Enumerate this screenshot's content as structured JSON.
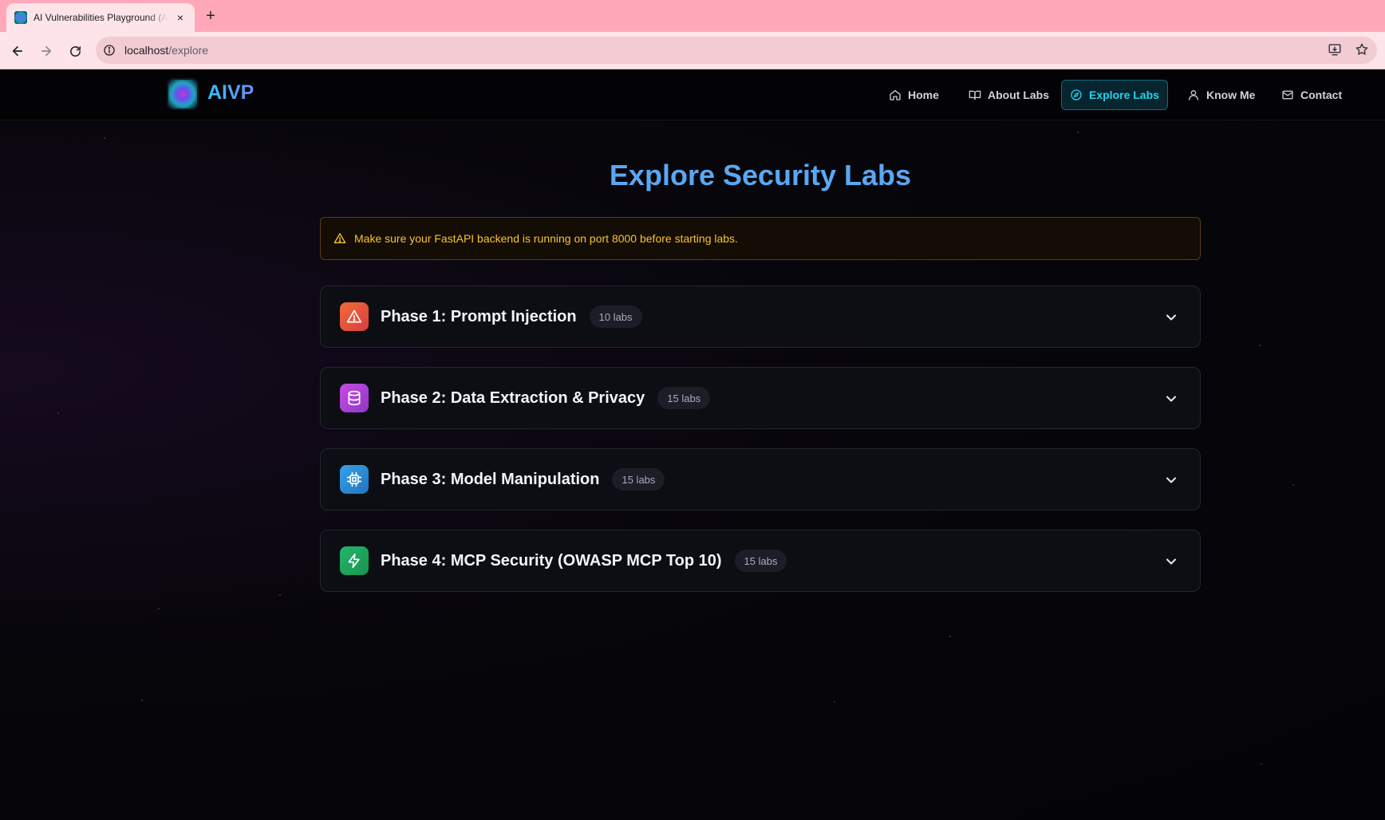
{
  "browser": {
    "tab_title": "AI Vulnerabilities Playground (AIVP)",
    "tab_close": "×",
    "new_tab": "+",
    "url_host": "localhost",
    "url_path": "/explore"
  },
  "site": {
    "brand": "AIVP",
    "nav": [
      {
        "label": "Home",
        "icon": "home-icon"
      },
      {
        "label": "About Labs",
        "icon": "book-icon"
      },
      {
        "label": "Explore Labs",
        "icon": "compass-icon",
        "active": true
      },
      {
        "label": "Know Me",
        "icon": "user-icon"
      },
      {
        "label": "Contact",
        "icon": "mail-icon"
      }
    ],
    "colors": {
      "accent": "#22d3ee",
      "title": "#5aa7f3",
      "warning": "#f8c32e"
    }
  },
  "main": {
    "title": "Explore Security Labs",
    "warning": "Make sure your FastAPI backend is running on port 8000 before starting labs.",
    "phases": [
      {
        "title": "Phase 1: Prompt Injection",
        "count": "10 labs",
        "icon": "alert-triangle-icon",
        "color": "#e4573a"
      },
      {
        "title": "Phase 2: Data Extraction & Privacy",
        "count": "15 labs",
        "icon": "database-icon",
        "color": "#b43fd6"
      },
      {
        "title": "Phase 3: Model Manipulation",
        "count": "15 labs",
        "icon": "cpu-icon",
        "color": "#2d8fd5"
      },
      {
        "title": "Phase 4: MCP Security (OWASP MCP Top 10)",
        "count": "15 labs",
        "icon": "zap-icon",
        "color": "#1fa463"
      }
    ]
  }
}
